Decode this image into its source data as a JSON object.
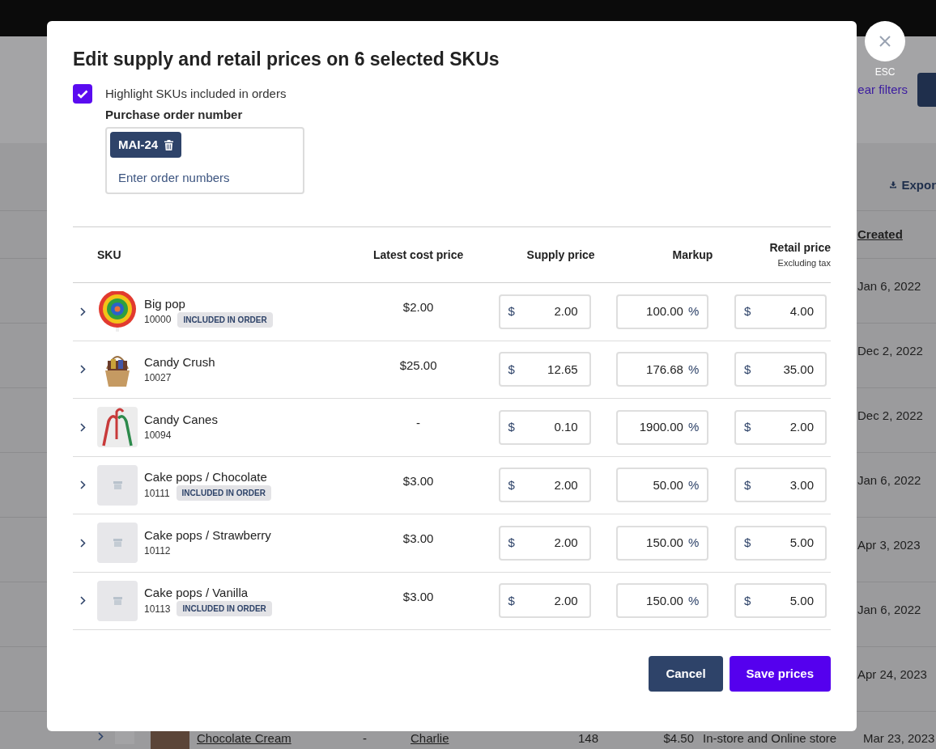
{
  "background": {
    "filter_link": "ear filters",
    "export_button": "Expor",
    "created_header": "Created",
    "dates": [
      "Jan 6, 2022",
      "Dec 2, 2022",
      "Dec 2, 2022",
      "Jan 6, 2022",
      "Apr 3, 2023",
      "Jan 6, 2022",
      "Apr 24, 2023"
    ],
    "bottom_row": {
      "name": "Chocolate Cream",
      "column_2": "-",
      "column_3": "Charlie",
      "column_4": "148",
      "column_5": "$4.50",
      "column_6": "In-store and Online store",
      "created": "Mar 23, 2023"
    }
  },
  "dialog": {
    "title": "Edit supply and retail prices on 6 selected SKUs",
    "close_label": "ESC",
    "highlight": {
      "label": "Highlight SKUs included in orders",
      "checked": true
    },
    "order_field": {
      "label": "Purchase order number",
      "tags": [
        "MAI-24"
      ],
      "placeholder": "Enter order numbers"
    },
    "table": {
      "columns": [
        {
          "label": "SKU"
        },
        {
          "label": "Latest cost price"
        },
        {
          "label": "Supply price"
        },
        {
          "label": "Markup"
        },
        {
          "label": "Retail price",
          "note": "Excluding tax"
        }
      ],
      "rows": [
        {
          "name": "Big pop",
          "sku": "10000",
          "badge": "INCLUDED IN ORDER",
          "kind": "lollipop",
          "latest_cost": "$2.00",
          "supply": {
            "prefix": "$",
            "value": "2.00"
          },
          "markup": {
            "value": "100.00",
            "suffix": "%"
          },
          "retail": {
            "prefix": "$",
            "value": "4.00"
          }
        },
        {
          "name": "Candy Crush",
          "sku": "10027",
          "kind": "basket",
          "latest_cost": "$25.00",
          "supply": {
            "prefix": "$",
            "value": "12.65"
          },
          "markup": {
            "value": "176.68",
            "suffix": "%"
          },
          "retail": {
            "prefix": "$",
            "value": "35.00"
          }
        },
        {
          "name": "Candy Canes",
          "sku": "10094",
          "kind": "candy-canes",
          "latest_cost": "-",
          "supply": {
            "prefix": "$",
            "value": "0.10"
          },
          "markup": {
            "value": "1900.00",
            "suffix": "%"
          },
          "retail": {
            "prefix": "$",
            "value": "2.00"
          }
        },
        {
          "name": "Cake pops / Chocolate",
          "sku": "10111",
          "badge": "INCLUDED IN ORDER",
          "kind": "none",
          "latest_cost": "$3.00",
          "supply": {
            "prefix": "$",
            "value": "2.00"
          },
          "markup": {
            "value": "50.00",
            "suffix": "%"
          },
          "retail": {
            "prefix": "$",
            "value": "3.00"
          }
        },
        {
          "name": "Cake pops / Strawberry",
          "sku": "10112",
          "kind": "none",
          "latest_cost": "$3.00",
          "supply": {
            "prefix": "$",
            "value": "2.00"
          },
          "markup": {
            "value": "150.00",
            "suffix": "%"
          },
          "retail": {
            "prefix": "$",
            "value": "5.00"
          }
        },
        {
          "name": "Cake pops / Vanilla",
          "sku": "10113",
          "badge": "INCLUDED IN ORDER",
          "kind": "none",
          "latest_cost": "$3.00",
          "supply": {
            "prefix": "$",
            "value": "2.00"
          },
          "markup": {
            "value": "150.00",
            "suffix": "%"
          },
          "retail": {
            "prefix": "$",
            "value": "5.00"
          }
        }
      ]
    },
    "buttons": [
      {
        "label": "Cancel",
        "kind": "secondary"
      },
      {
        "label": "Save prices",
        "kind": "primary"
      }
    ]
  }
}
